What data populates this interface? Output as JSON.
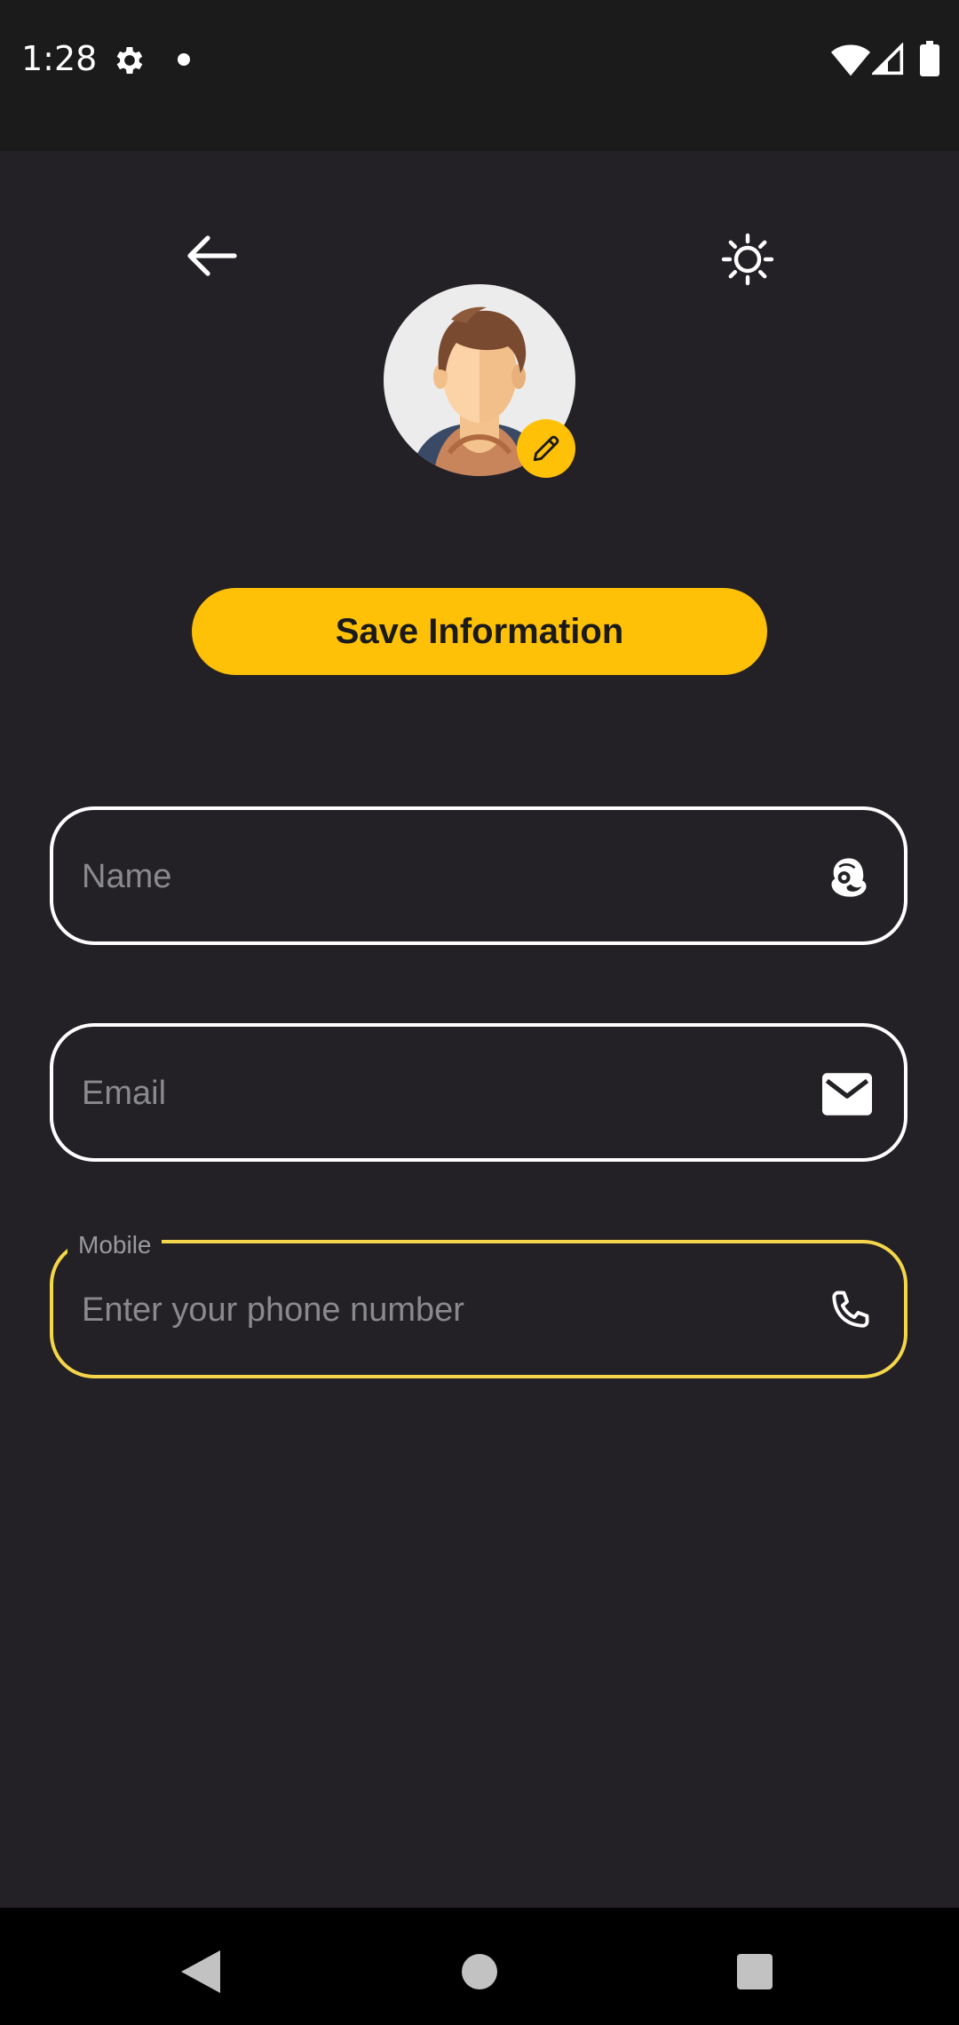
{
  "status_bar": {
    "time": "1:28",
    "icons": [
      "gear-icon",
      "notification-dot",
      "wifi-icon",
      "signal-icon",
      "battery-icon"
    ]
  },
  "top_bar": {
    "back_icon": "arrow-left-icon",
    "theme_icon": "sun-icon"
  },
  "profile": {
    "avatar": "male-avatar",
    "edit_icon": "pencil-icon"
  },
  "save_button": {
    "label": "Save Information"
  },
  "form": {
    "name": {
      "placeholder": "Name",
      "value": "",
      "icon": "mailchimp-icon"
    },
    "email": {
      "placeholder": "Email",
      "value": "",
      "icon": "envelope-icon"
    },
    "mobile": {
      "label": "Mobile",
      "placeholder": "Enter your phone number",
      "value": "",
      "icon": "phone-icon"
    }
  },
  "colors": {
    "background": "#232126",
    "accent": "#ffc107",
    "focus_border": "#f5d64a",
    "border": "#ffffff",
    "placeholder": "#8a8a8e"
  },
  "nav_bar": {
    "icons": [
      "back-triangle-icon",
      "home-circle-icon",
      "recents-square-icon"
    ]
  }
}
